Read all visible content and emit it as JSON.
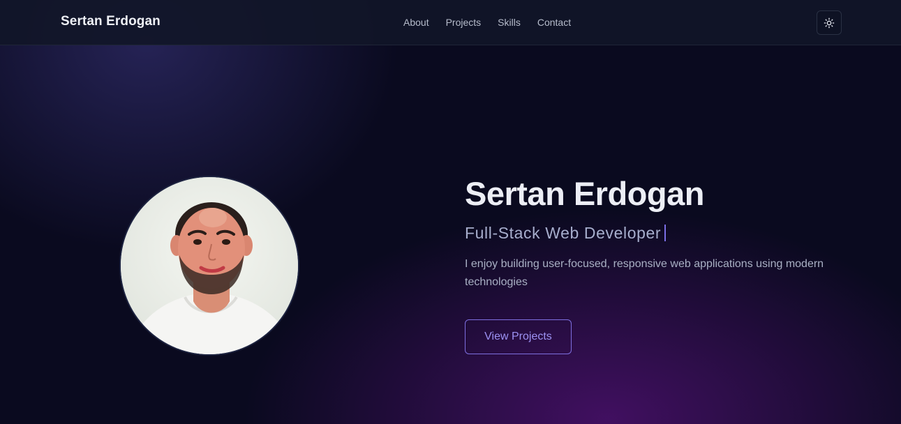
{
  "nav": {
    "brand": "Sertan Erdogan",
    "links": [
      "About",
      "Projects",
      "Skills",
      "Contact"
    ],
    "theme_toggle_icon": "sun-icon"
  },
  "hero": {
    "name": "Sertan Erdogan",
    "role": "Full-Stack Web Developer",
    "description": "I enjoy building user-focused, responsive web applications using modern technologies",
    "cta_label": "View Projects"
  },
  "colors": {
    "background": "#0a0a1f",
    "accent": "#7e6fe0",
    "glow_purple": "#6e1496",
    "glow_blue": "#3c3782"
  }
}
